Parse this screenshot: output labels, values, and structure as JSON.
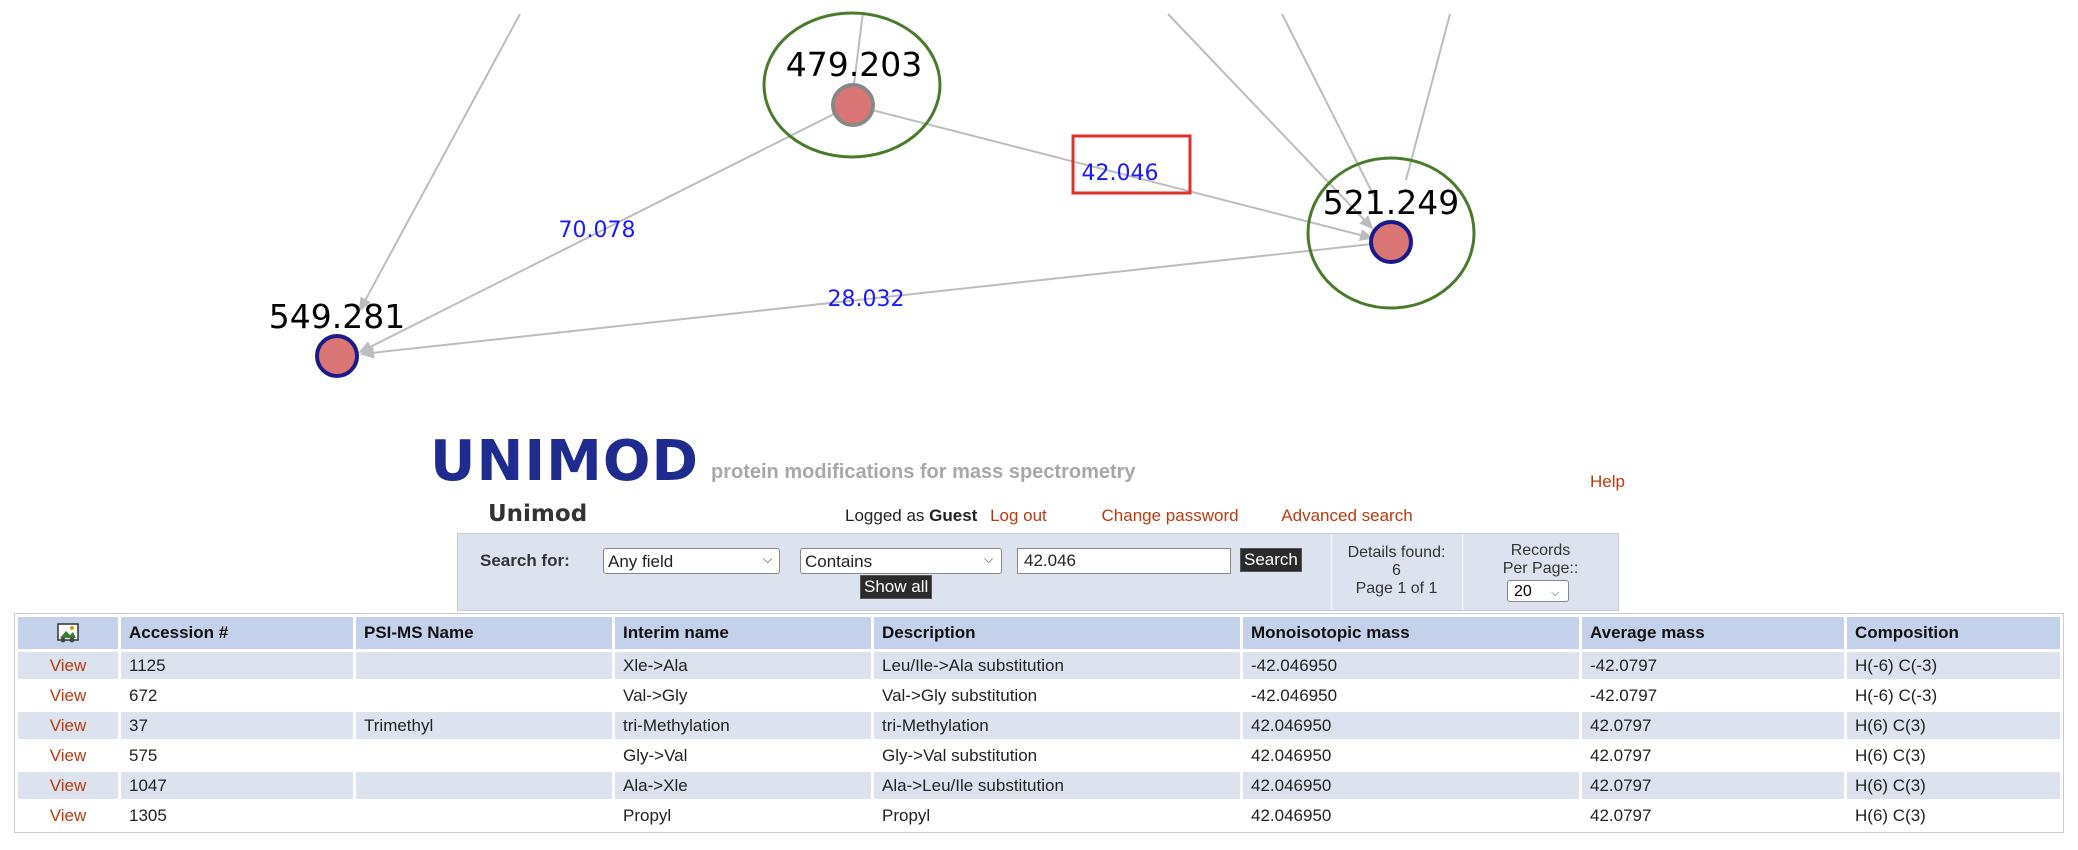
{
  "graph": {
    "nodes": [
      {
        "id": "n479",
        "label": "479.203"
      },
      {
        "id": "n521",
        "label": "521.249"
      },
      {
        "id": "n549",
        "label": "549.281"
      }
    ],
    "edge_labels": [
      "70.078",
      "42.046",
      "28.032"
    ]
  },
  "header": {
    "logo_text": "UNIMOD",
    "tagline": "protein modifications for mass spectrometry",
    "help": "Help",
    "title": "Unimod",
    "logged_as": "Logged as",
    "user": "Guest",
    "logout": "Log out",
    "change_password": "Change password",
    "advanced_search": "Advanced search"
  },
  "search": {
    "label": "Search for:",
    "field": "Any field",
    "match": "Contains",
    "query": "42.046",
    "search_button": "Search",
    "show_all": "Show all",
    "details_found_label": "Details found:",
    "details_count": "6",
    "page_info": "Page 1 of 1",
    "records_per_page_label": "Records Per Page::",
    "records_per_page": "20"
  },
  "table": {
    "headers": [
      "Accession #",
      "PSI-MS Name",
      "Interim name",
      "Description",
      "Monoisotopic mass",
      "Average mass",
      "Composition"
    ],
    "view_label": "View",
    "rows": [
      [
        "1125",
        "",
        "Xle->Ala",
        "Leu/Ile->Ala substitution",
        "-42.046950",
        "-42.0797",
        "H(-6) C(-3)"
      ],
      [
        "672",
        "",
        "Val->Gly",
        "Val->Gly substitution",
        "-42.046950",
        "-42.0797",
        "H(-6) C(-3)"
      ],
      [
        "37",
        "Trimethyl",
        "tri-Methylation",
        "tri-Methylation",
        "42.046950",
        "42.0797",
        "H(6) C(3)"
      ],
      [
        "575",
        "",
        "Gly->Val",
        "Gly->Val substitution",
        "42.046950",
        "42.0797",
        "H(6) C(3)"
      ],
      [
        "1047",
        "",
        "Ala->Xle",
        "Ala->Leu/Ile substitution",
        "42.046950",
        "42.0797",
        "H(6) C(3)"
      ],
      [
        "1305",
        "",
        "Propyl",
        "Propyl",
        "42.046950",
        "42.0797",
        "H(6) C(3)"
      ]
    ]
  },
  "colors": {
    "accent_link": "#b83a0e",
    "node_fill": "#d97575",
    "node_border": "#1a1a8c",
    "cluster": "#4a7a2c",
    "edge_label": "#1a1aff",
    "highlight": "#e0302a"
  }
}
